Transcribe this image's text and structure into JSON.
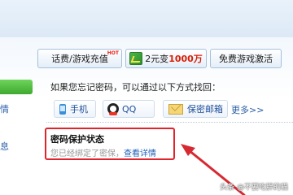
{
  "toolbar": {
    "recharge_label": "话费/游戏充值",
    "recharge_badge": "HOT",
    "promo_prefix": "2元变",
    "promo_highlight": "1000万",
    "free_activate_label": "免费游戏激活"
  },
  "left": {
    "frag_1": "情",
    "frag_2": "息"
  },
  "recovery": {
    "prompt": "如果您忘记密码，可以通过以下方式找回：",
    "options": [
      {
        "label": "手机",
        "icon": "phone-icon"
      },
      {
        "label": "QQ",
        "icon": "qq-icon"
      },
      {
        "label": "保密邮箱",
        "icon": "mail-icon"
      }
    ],
    "more": "更多>>"
  },
  "status": {
    "title": "密码保护状态",
    "text": "您已经绑定了密保，",
    "link": "查看详情"
  },
  "watermark": "头条 @不要吃胖的猫",
  "colors": {
    "highlight": "#e0242b",
    "link": "#1d5fb7",
    "arrow": "#d62a32"
  }
}
